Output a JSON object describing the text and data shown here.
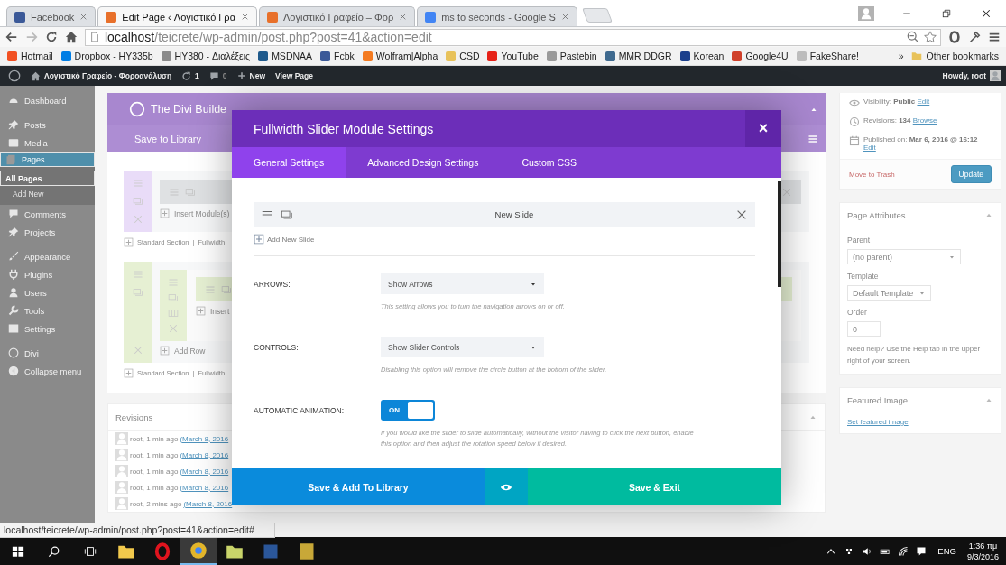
{
  "browser": {
    "tabs": [
      {
        "title": "Facebook",
        "selected": false,
        "color": "#3b5998"
      },
      {
        "title": "Edit Page ‹ Λογιστικό Γρα",
        "selected": true,
        "color": "#e8702a"
      },
      {
        "title": "Λογιστικό Γραφείο – Φορ",
        "selected": false,
        "color": "#e8702a"
      },
      {
        "title": "ms to seconds - Google S",
        "selected": false,
        "color": "#4285f4"
      }
    ],
    "address": {
      "host": "localhost",
      "path": "/teicrete/wp-admin/post.php?post=41&action=edit"
    },
    "bookmarks": [
      {
        "label": "Hotmail",
        "color": "#f25022"
      },
      {
        "label": "Dropbox - HY335b",
        "color": "#007ee5"
      },
      {
        "label": "HY380 - Διαλέξεις",
        "color": "#8a8a8a"
      },
      {
        "label": "MSDNAA",
        "color": "#1f5a8c"
      },
      {
        "label": "Fcbk",
        "color": "#3b5998"
      },
      {
        "label": "Wolfram|Alpha",
        "color": "#f47a20"
      },
      {
        "label": "CSD",
        "color": "#e8c25a"
      },
      {
        "label": "YouTube",
        "color": "#e62117"
      },
      {
        "label": "Pastebin",
        "color": "#9a9a9a"
      },
      {
        "label": "MMR DDGR",
        "color": "#3f6a8f"
      },
      {
        "label": "Korean",
        "color": "#1b3f8c"
      },
      {
        "label": "Google4U",
        "color": "#d0402a"
      },
      {
        "label": "FakeShare!",
        "color": "#bdbdbd"
      }
    ],
    "more": "»",
    "other_bookmarks": "Other bookmarks"
  },
  "admin_bar": {
    "site": "Λογιστικό Γραφείο - Φοροανάλυση",
    "updates": "1",
    "comments": "0",
    "new": "New",
    "view_page": "View Page",
    "howdy": "Howdy, root"
  },
  "admin_menu": [
    {
      "items": [
        {
          "label": "Dashboard",
          "selected": false
        }
      ]
    },
    {
      "items": [
        {
          "label": "Posts",
          "selected": false
        },
        {
          "label": "Media",
          "selected": false
        },
        {
          "label": "Pages",
          "selected": true,
          "children": [
            {
              "label": "All Pages",
              "selected": true
            },
            {
              "label": "Add New",
              "selected": false
            }
          ]
        },
        {
          "label": "Comments",
          "selected": false
        },
        {
          "label": "Projects",
          "selected": false
        }
      ]
    },
    {
      "items": [
        {
          "label": "Appearance",
          "selected": false
        },
        {
          "label": "Plugins",
          "selected": false
        },
        {
          "label": "Users",
          "selected": false
        },
        {
          "label": "Tools",
          "selected": false
        },
        {
          "label": "Settings",
          "selected": false
        }
      ]
    },
    {
      "items": [
        {
          "label": "Divi",
          "selected": false
        },
        {
          "label": "Collapse menu",
          "selected": false
        }
      ]
    }
  ],
  "builder": {
    "title": "The Divi Builde",
    "save_to_library": "Save to Library",
    "sections": [
      {
        "kind": "single",
        "color": "#e9dcf8",
        "insert": "Insert Module(s)",
        "links": [
          "Standard Section",
          "Fullwidth"
        ],
        "separator": "|"
      },
      {
        "kind": "nested",
        "color": "#e6f0d3",
        "insert": "Insert",
        "add_row": "Add Row",
        "links": [
          "Standard Section",
          "Fullwidth"
        ],
        "separator": "|"
      }
    ]
  },
  "revisions": {
    "title": "Revisions",
    "rows": [
      {
        "author": "root, 1 min ago",
        "date": "(March 8, 2016"
      },
      {
        "author": "root, 1 min ago",
        "date": "(March 8, 2016"
      },
      {
        "author": "root, 1 min ago",
        "date": "(March 8, 2016"
      },
      {
        "author": "root, 1 min ago",
        "date": "(March 8, 2016"
      },
      {
        "author": "root, 2 mins ago",
        "date": "(March 8, 2016"
      }
    ]
  },
  "publish": {
    "rows": [
      {
        "label": "Visibility:",
        "value": "Public",
        "link": "Edit"
      },
      {
        "label": "Revisions:",
        "value": "134",
        "link": "Browse"
      },
      {
        "label": "Published on:",
        "value": "Mar 6, 2016 @ 16:12",
        "link": "Edit"
      }
    ],
    "trash": "Move to Trash",
    "update": "Update"
  },
  "page_attributes": {
    "title": "Page Attributes",
    "parent_label": "Parent",
    "parent": "(no parent)",
    "template_label": "Template",
    "template": "Default Template",
    "order_label": "Order",
    "order": "0",
    "help": "Need help? Use the Help tab in the upper right of your screen."
  },
  "featured_image": {
    "title": "Featured Image",
    "link": "Set featured image"
  },
  "modal": {
    "title": "Fullwidth Slider Module Settings",
    "close": "×",
    "tabs": [
      {
        "label": "General Settings",
        "selected": true
      },
      {
        "label": "Advanced Design Settings",
        "selected": false
      },
      {
        "label": "Custom CSS",
        "selected": false
      }
    ],
    "slide": "New Slide",
    "add_slide": "Add New Slide",
    "settings": [
      {
        "kind": "select",
        "label": "ARROWS:",
        "value": "Show Arrows",
        "description": "This setting allows you to turn the navigation arrows on or off."
      },
      {
        "kind": "select",
        "label": "CONTROLS:",
        "value": "Show Slider Controls",
        "description": "Disabling this option will remove the circle button at the bottom of the slider."
      },
      {
        "kind": "toggle",
        "label": "AUTOMATIC ANIMATION:",
        "on": true,
        "state_label": "ON",
        "description": "If you would like the slider to slide automatically, without the visitor having to click the next button, enable this option and then adjust the rotation speed below if desired."
      }
    ],
    "save_library": "Save & Add To Library",
    "save_exit": "Save & Exit"
  },
  "status_url": "localhost/teicrete/wp-admin/post.php?post=41&action=edit#",
  "taskbar": {
    "apps": [
      {
        "selected": false
      },
      {
        "selected": false
      },
      {
        "selected": true
      },
      {
        "selected": false
      },
      {
        "selected": false
      },
      {
        "selected": false
      }
    ],
    "language": "ENG",
    "time": "1:36 πμ",
    "date": "9/3/2016"
  }
}
